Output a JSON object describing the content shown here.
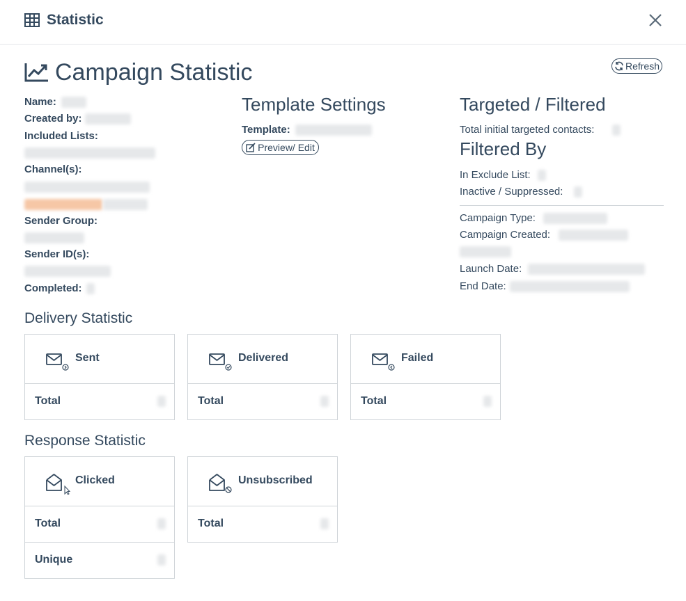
{
  "header": {
    "title": "Statistic"
  },
  "page": {
    "title": "Campaign Statistic",
    "refresh_label": "Refresh"
  },
  "details": {
    "name_label": "Name:",
    "created_by_label": "Created by:",
    "included_lists_label": "Included Lists:",
    "channels_label": "Channel(s):",
    "sender_group_label": "Sender Group:",
    "sender_ids_label": "Sender ID(s):",
    "completed_label": "Completed:"
  },
  "template_settings": {
    "heading": "Template Settings",
    "template_label": "Template:",
    "preview_label": "Preview/ Edit"
  },
  "targeted": {
    "heading": "Targeted / Filtered",
    "total_initial_label": "Total initial targeted contacts:",
    "filtered_by_heading": "Filtered By",
    "exclude_list_label": "In Exclude List:",
    "inactive_label": "Inactive / Suppressed:",
    "campaign_type_label": "Campaign Type:",
    "campaign_created_label": "Campaign Created:",
    "launch_date_label": "Launch Date:",
    "end_date_label": "End Date:"
  },
  "delivery": {
    "heading": "Delivery Statistic",
    "cards": [
      {
        "name": "Sent",
        "icon": "envelope-sent-icon",
        "rows": [
          {
            "label": "Total"
          }
        ]
      },
      {
        "name": "Delivered",
        "icon": "envelope-delivered-icon",
        "rows": [
          {
            "label": "Total"
          }
        ]
      },
      {
        "name": "Failed",
        "icon": "envelope-failed-icon",
        "rows": [
          {
            "label": "Total"
          }
        ]
      }
    ]
  },
  "response": {
    "heading": "Response Statistic",
    "cards": [
      {
        "name": "Clicked",
        "icon": "envelope-open-clicked-icon",
        "rows": [
          {
            "label": "Total"
          },
          {
            "label": "Unique"
          }
        ]
      },
      {
        "name": "Unsubscribed",
        "icon": "envelope-open-unsubscribed-icon",
        "rows": [
          {
            "label": "Total"
          }
        ]
      }
    ]
  },
  "colors": {
    "text": "#34495e",
    "border": "#cfd4d8",
    "redacted": "#e6e8ea",
    "redacted_accent": "#f6c7a6"
  }
}
